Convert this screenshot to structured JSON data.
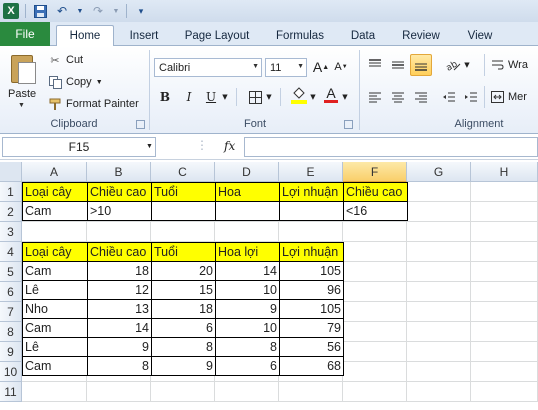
{
  "quick_access": {
    "app_icon": "X",
    "icons": [
      "excel-icon",
      "save-icon",
      "undo-icon",
      "redo-icon",
      "customize-icon"
    ]
  },
  "tabs": [
    "File",
    "Home",
    "Insert",
    "Page Layout",
    "Formulas",
    "Data",
    "Review",
    "View"
  ],
  "ribbon": {
    "clipboard": {
      "label": "Clipboard",
      "paste": "Paste",
      "cut": "Cut",
      "copy": "Copy",
      "format_painter": "Format Painter"
    },
    "font": {
      "label": "Font",
      "font_name": "Calibri",
      "font_size": "11",
      "grow": "A",
      "shrink": "A",
      "bold": "B",
      "italic": "I",
      "underline": "U",
      "font_color": "A"
    },
    "alignment": {
      "label": "Alignment",
      "wrap": "Wra",
      "merge": "Mer"
    }
  },
  "formula_bar": {
    "name_box": "F15",
    "fx": "fx",
    "formula": ""
  },
  "grid": {
    "columns": [
      "A",
      "B",
      "C",
      "D",
      "E",
      "F",
      "G",
      "H"
    ],
    "selected_column": "F",
    "rows": [
      "1",
      "2",
      "3",
      "4",
      "5",
      "6",
      "7",
      "8",
      "9",
      "10",
      "11"
    ],
    "criteria_header": [
      "Loại cây",
      "Chiều cao",
      "Tuổi",
      "Hoa",
      "Lợi nhuận",
      "Chiều cao"
    ],
    "criteria_values": [
      "Cam",
      ">10",
      "",
      "",
      "",
      "<16"
    ],
    "data_header": [
      "Loại cây",
      "Chiều cao",
      "Tuổi",
      "Hoa lợi",
      "Lợi nhuận"
    ],
    "data_rows": [
      [
        "Cam",
        "18",
        "20",
        "14",
        "105"
      ],
      [
        "Lê",
        "12",
        "15",
        "10",
        "96"
      ],
      [
        "Nho",
        "13",
        "18",
        "9",
        "105"
      ],
      [
        "Cam",
        "14",
        "6",
        "10",
        "79"
      ],
      [
        "Lê",
        "9",
        "8",
        "8",
        "56"
      ],
      [
        "Cam",
        "8",
        "9",
        "6",
        "68"
      ]
    ]
  },
  "colors": {
    "header_fill": "#ffff00",
    "file_tab": "#2a8a3e"
  }
}
